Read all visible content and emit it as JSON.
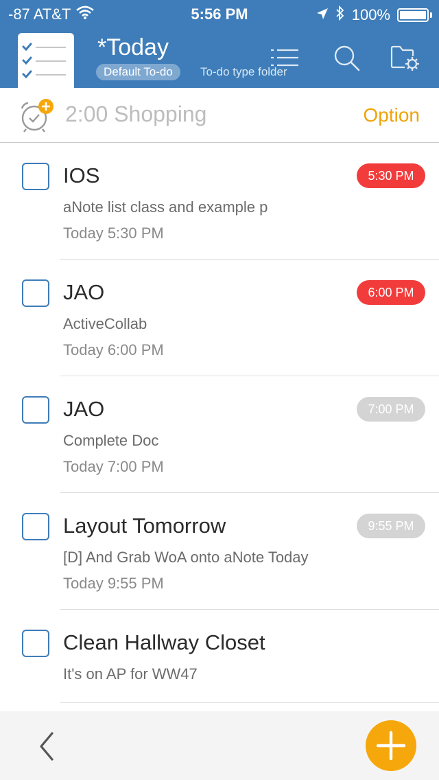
{
  "status_bar": {
    "carrier": "-87 AT&T",
    "time": "5:56 PM",
    "battery": "100%"
  },
  "header": {
    "title": "*Today",
    "folder_name": "Default To-do",
    "folder_type": "To-do type folder",
    "icons": [
      "checklist-app-icon",
      "list-view-icon",
      "search-icon",
      "folder-settings-icon"
    ]
  },
  "quick_add": {
    "text": "2:00 Shopping",
    "option_label": "Option"
  },
  "todos": [
    {
      "title": "IOS",
      "note": "aNote list class and example p",
      "date": "Today 5:30 PM",
      "badge": "5:30 PM",
      "badge_status": "overdue"
    },
    {
      "title": "JAO",
      "note": "ActiveCollab",
      "date": "Today 6:00 PM",
      "badge": "6:00 PM",
      "badge_status": "overdue"
    },
    {
      "title": "JAO",
      "note": "Complete Doc",
      "date": "Today 7:00 PM",
      "badge": "7:00 PM",
      "badge_status": "upcoming"
    },
    {
      "title": "Layout Tomorrow",
      "note": "[D] And Grab WoA onto aNote Today",
      "date": "Today 9:55 PM",
      "badge": "9:55 PM",
      "badge_status": "upcoming"
    },
    {
      "title": "Clean Hallway Closet",
      "note": "It's on AP for WW47",
      "date": "",
      "badge": "",
      "badge_status": "none"
    }
  ],
  "colors": {
    "header_blue": "#3e7db9",
    "accent_orange": "#f5a70b",
    "badge_overdue": "#f23c3c",
    "badge_upcoming": "#d4d4d4"
  }
}
